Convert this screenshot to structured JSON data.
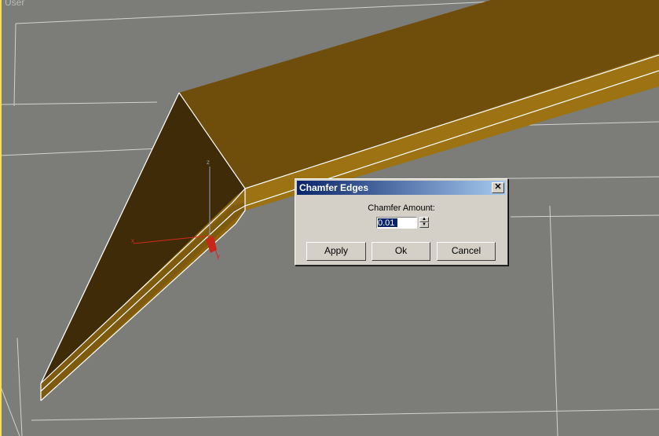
{
  "viewport": {
    "label": "User",
    "axes": {
      "x": "x",
      "y": "y",
      "z": "z"
    }
  },
  "dialog": {
    "title": "Chamfer Edges",
    "close_glyph": "✕",
    "amount_label": "Chamfer Amount:",
    "amount_value": "0.01",
    "spinner_up": "▲",
    "spinner_down": "▼",
    "apply_label": "Apply",
    "ok_label": "Ok",
    "cancel_label": "Cancel"
  },
  "colors": {
    "viewport_bg": "#7c7c79",
    "object_top": "#6f4d0b",
    "object_side": "#9d7212",
    "object_inner": "#3f2b08",
    "selection_edges": "#ffffff",
    "titlebar": "#0a246a"
  }
}
